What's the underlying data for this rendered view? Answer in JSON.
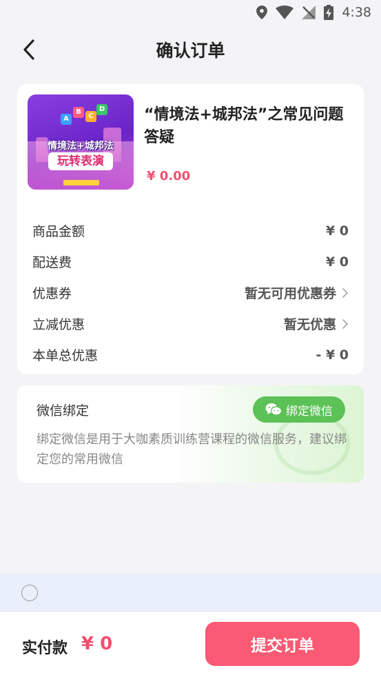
{
  "status_bar": {
    "time": "4:38",
    "icons": [
      "location-icon",
      "wifi-icon",
      "no-signal-icon",
      "battery-charging-icon"
    ]
  },
  "header": {
    "title": "确认订单",
    "back_icon": "chevron-left-icon"
  },
  "product": {
    "title": "“情境法+城邦法”之常见问题答疑",
    "price": "¥ 0.00",
    "thumbnail": {
      "title": "情境法+城邦法",
      "subtitle": "玩转表演"
    }
  },
  "summary": {
    "rows": [
      {
        "label": "商品金额",
        "value": "¥ 0"
      },
      {
        "label": "配送费",
        "value": "¥ 0"
      },
      {
        "label": "优惠券",
        "value": "暂无可用优惠券"
      },
      {
        "label": "立减优惠",
        "value": "暂无优惠"
      },
      {
        "label": "本单总优惠",
        "value": "- ¥ 0"
      }
    ]
  },
  "wechat": {
    "title": "微信绑定",
    "bind_label": "绑定微信",
    "description": "绑定微信是用于大咖素质训练营课程的微信服务，建议绑定您的常用微信",
    "icon": "wechat-icon"
  },
  "footer": {
    "pay_label": "实付款",
    "pay_amount": "¥ 0",
    "submit_label": "提交订单"
  },
  "colors": {
    "accent": "#fa5a74",
    "price": "#f0506e",
    "wechat_green": "#5cc156",
    "background": "#f4f4f7"
  }
}
